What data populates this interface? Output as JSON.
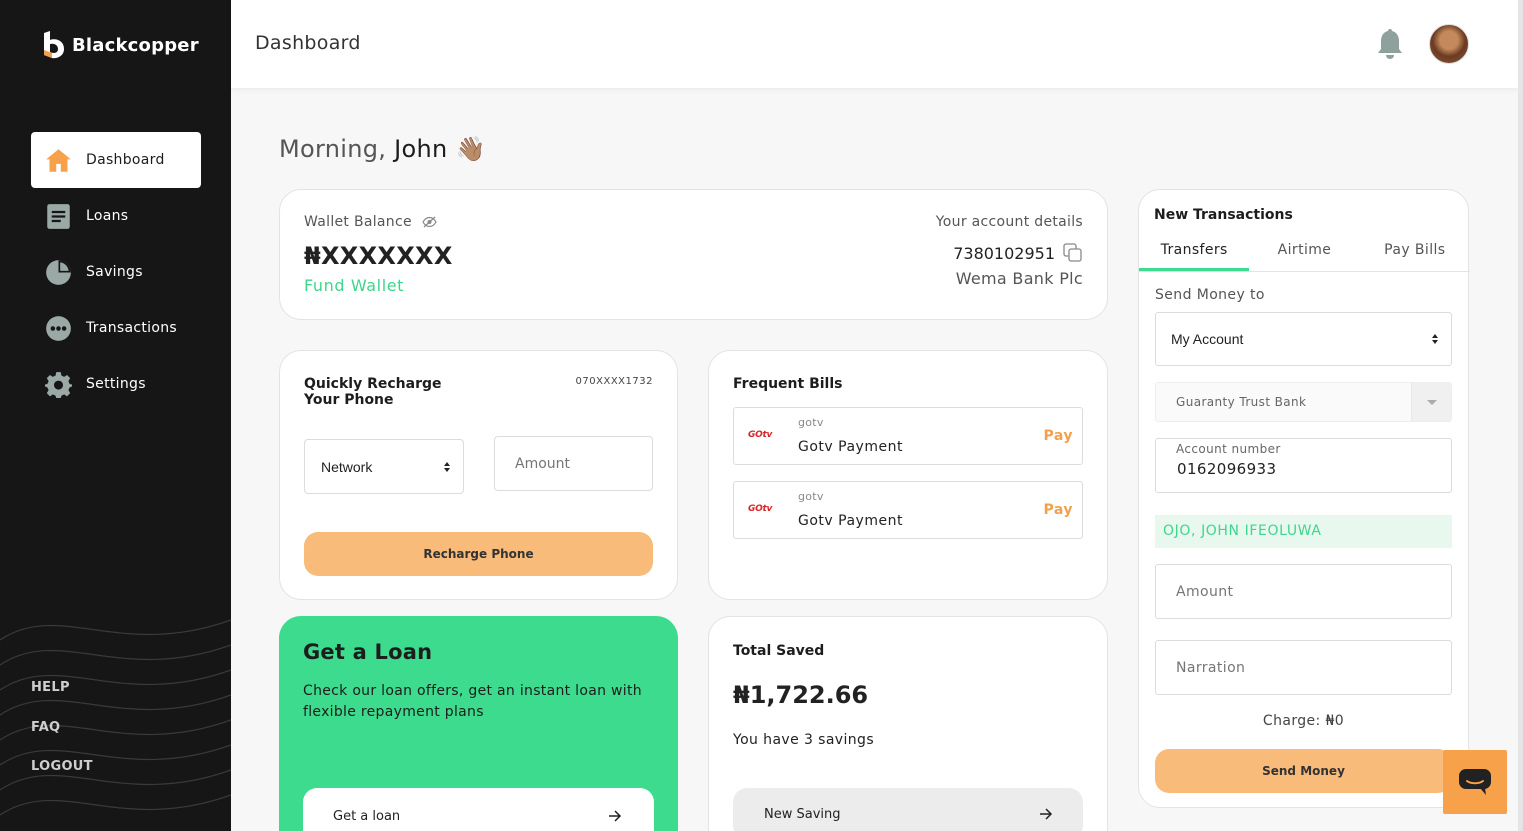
{
  "app": {
    "brand": "Blackcopper"
  },
  "sidebar": {
    "items": [
      {
        "label": "Dashboard",
        "icon": "home-icon",
        "active": true
      },
      {
        "label": "Loans",
        "icon": "document-icon"
      },
      {
        "label": "Savings",
        "icon": "pie-chart-icon"
      },
      {
        "label": "Transactions",
        "icon": "dots-circle-icon"
      },
      {
        "label": "Settings",
        "icon": "gear-icon"
      }
    ],
    "bottom_links": [
      "HELP",
      "FAQ",
      "LOGOUT"
    ]
  },
  "header": {
    "title": "Dashboard",
    "bell_icon": "bell-icon",
    "avatar": "user-avatar"
  },
  "greeting": {
    "prefix": "Morning,",
    "name": "John",
    "emoji": "👋🏽"
  },
  "wallet": {
    "label": "Wallet Balance",
    "balance": "₦XXXXXXX",
    "fund_label": "Fund Wallet",
    "account_details_label": "Your account details",
    "account_number": "7380102951",
    "bank_name": "Wema Bank Plc"
  },
  "recharge": {
    "title": "Quickly Recharge Your Phone",
    "phone": "070XXXX1732",
    "network_selected": "Network",
    "amount_placeholder": "Amount",
    "button_label": "Recharge Phone"
  },
  "bills": {
    "title": "Frequent Bills",
    "items": [
      {
        "logo": "GOtv",
        "provider": "gotv",
        "name": "Gotv Payment",
        "action": "Pay"
      },
      {
        "logo": "GOtv",
        "provider": "gotv",
        "name": "Gotv Payment",
        "action": "Pay"
      }
    ]
  },
  "loan": {
    "title": "Get a Loan",
    "description": "Check our loan offers, get an instant loan with flexible repayment plans",
    "button_label": "Get a loan"
  },
  "savings": {
    "title": "Total Saved",
    "amount": "₦1,722.66",
    "subtitle": "You have 3 savings",
    "button_label": "New Saving"
  },
  "transactions": {
    "title": "New Transactions",
    "tabs": [
      "Transfers",
      "Airtime",
      "Pay Bills"
    ],
    "active_tab": 0,
    "send_to_label": "Send Money to",
    "send_to_selected": "My Account",
    "bank_selected": "Guaranty Trust Bank",
    "account_number_label": "Account number",
    "account_number_value": "0162096933",
    "account_name": "OJO, JOHN IFEOLUWA",
    "amount_placeholder": "Amount",
    "narration_placeholder": "Narration",
    "charge_text": "Charge: ₦0",
    "button_label": "Send Money"
  },
  "colors": {
    "accent_green": "#3ddb8d",
    "accent_orange": "#f8bb7a",
    "sidebar_bg": "#161616"
  }
}
